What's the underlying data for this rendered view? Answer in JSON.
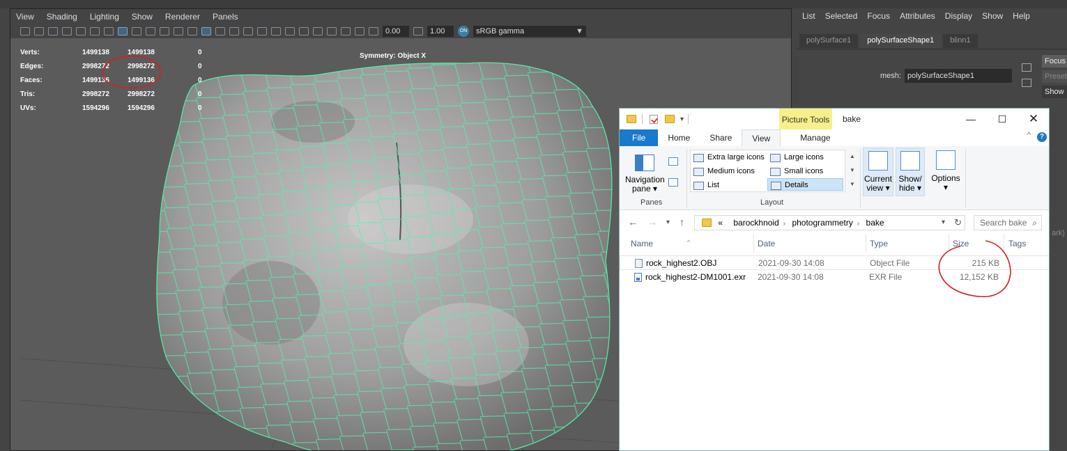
{
  "maya": {
    "menubar": [
      "View",
      "Shading",
      "Lighting",
      "Show",
      "Renderer",
      "Panels"
    ],
    "toolbar": {
      "field1": "0.00",
      "field2": "1.00",
      "colorspace": "sRGB gamma",
      "badge": "ON"
    },
    "hud": [
      {
        "label": "Verts:",
        "v1": "1499138",
        "v2": "1499138",
        "v3": "0"
      },
      {
        "label": "Edges:",
        "v1": "2998272",
        "v2": "2998272",
        "v3": "0"
      },
      {
        "label": "Faces:",
        "v1": "1499136",
        "v2": "1499136",
        "v3": "0"
      },
      {
        "label": "Tris:",
        "v1": "2998272",
        "v2": "2998272",
        "v3": "0"
      },
      {
        "label": "UVs:",
        "v1": "1594296",
        "v2": "1594296",
        "v3": "0"
      }
    ],
    "symmetry": "Symmetry: Object X",
    "mesh_color": "#55f0a8"
  },
  "attr": {
    "menu": [
      "List",
      "Selected",
      "Focus",
      "Attributes",
      "Display",
      "Show",
      "Help"
    ],
    "tabs": [
      "polySurface1",
      "polySurfaceShape1",
      "blinn1"
    ],
    "mesh_label": "mesh:",
    "mesh_value": "polySurfaceShape1",
    "btn_focus": "Focus",
    "btn_presets": "Presets",
    "btn_show": "Show",
    "ghost_text": "ark)"
  },
  "explorer": {
    "picture_tools": "Picture Tools",
    "title": "bake",
    "tabs": [
      "File",
      "Home",
      "Share",
      "View",
      "Manage"
    ],
    "ribbon": {
      "nav_pane": "Navigation pane",
      "panes_group": "Panes",
      "layout_items": [
        "Extra large icons",
        "Large icons",
        "Medium icons",
        "Small icons",
        "List",
        "Details"
      ],
      "layout_group": "Layout",
      "current_view": "Current view",
      "show_hide": "Show/ hide",
      "options": "Options"
    },
    "address": {
      "chevrons": "«",
      "crumbs": [
        "barockhnoid",
        "photogrammetry",
        "bake"
      ]
    },
    "search_placeholder": "Search bake",
    "columns": [
      "Name",
      "Date",
      "Type",
      "Size",
      "Tags"
    ],
    "files": [
      {
        "name": "rock_highest2.OBJ",
        "date": "2021-09-30 14:08",
        "type": "Object File",
        "size": "215 KB"
      },
      {
        "name": "rock_highest2-DM1001.exr",
        "date": "2021-09-30 14:08",
        "type": "EXR File",
        "size": "12,152 KB"
      }
    ],
    "accent": "#1979ca"
  },
  "annotation_color": "#d42020"
}
